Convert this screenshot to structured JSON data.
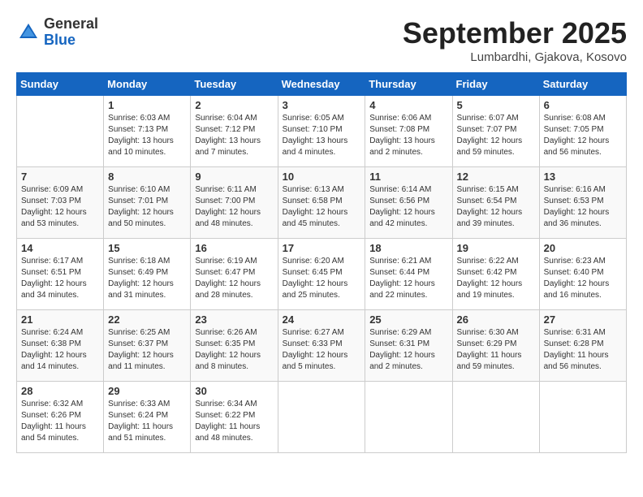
{
  "header": {
    "logo": {
      "line1": "General",
      "line2": "Blue"
    },
    "title": "September 2025",
    "subtitle": "Lumbardhi, Gjakova, Kosovo"
  },
  "weekdays": [
    "Sunday",
    "Monday",
    "Tuesday",
    "Wednesday",
    "Thursday",
    "Friday",
    "Saturday"
  ],
  "weeks": [
    [
      {
        "day": "",
        "sunrise": "",
        "sunset": "",
        "daylight": ""
      },
      {
        "day": "1",
        "sunrise": "Sunrise: 6:03 AM",
        "sunset": "Sunset: 7:13 PM",
        "daylight": "Daylight: 13 hours and 10 minutes."
      },
      {
        "day": "2",
        "sunrise": "Sunrise: 6:04 AM",
        "sunset": "Sunset: 7:12 PM",
        "daylight": "Daylight: 13 hours and 7 minutes."
      },
      {
        "day": "3",
        "sunrise": "Sunrise: 6:05 AM",
        "sunset": "Sunset: 7:10 PM",
        "daylight": "Daylight: 13 hours and 4 minutes."
      },
      {
        "day": "4",
        "sunrise": "Sunrise: 6:06 AM",
        "sunset": "Sunset: 7:08 PM",
        "daylight": "Daylight: 13 hours and 2 minutes."
      },
      {
        "day": "5",
        "sunrise": "Sunrise: 6:07 AM",
        "sunset": "Sunset: 7:07 PM",
        "daylight": "Daylight: 12 hours and 59 minutes."
      },
      {
        "day": "6",
        "sunrise": "Sunrise: 6:08 AM",
        "sunset": "Sunset: 7:05 PM",
        "daylight": "Daylight: 12 hours and 56 minutes."
      }
    ],
    [
      {
        "day": "7",
        "sunrise": "Sunrise: 6:09 AM",
        "sunset": "Sunset: 7:03 PM",
        "daylight": "Daylight: 12 hours and 53 minutes."
      },
      {
        "day": "8",
        "sunrise": "Sunrise: 6:10 AM",
        "sunset": "Sunset: 7:01 PM",
        "daylight": "Daylight: 12 hours and 50 minutes."
      },
      {
        "day": "9",
        "sunrise": "Sunrise: 6:11 AM",
        "sunset": "Sunset: 7:00 PM",
        "daylight": "Daylight: 12 hours and 48 minutes."
      },
      {
        "day": "10",
        "sunrise": "Sunrise: 6:13 AM",
        "sunset": "Sunset: 6:58 PM",
        "daylight": "Daylight: 12 hours and 45 minutes."
      },
      {
        "day": "11",
        "sunrise": "Sunrise: 6:14 AM",
        "sunset": "Sunset: 6:56 PM",
        "daylight": "Daylight: 12 hours and 42 minutes."
      },
      {
        "day": "12",
        "sunrise": "Sunrise: 6:15 AM",
        "sunset": "Sunset: 6:54 PM",
        "daylight": "Daylight: 12 hours and 39 minutes."
      },
      {
        "day": "13",
        "sunrise": "Sunrise: 6:16 AM",
        "sunset": "Sunset: 6:53 PM",
        "daylight": "Daylight: 12 hours and 36 minutes."
      }
    ],
    [
      {
        "day": "14",
        "sunrise": "Sunrise: 6:17 AM",
        "sunset": "Sunset: 6:51 PM",
        "daylight": "Daylight: 12 hours and 34 minutes."
      },
      {
        "day": "15",
        "sunrise": "Sunrise: 6:18 AM",
        "sunset": "Sunset: 6:49 PM",
        "daylight": "Daylight: 12 hours and 31 minutes."
      },
      {
        "day": "16",
        "sunrise": "Sunrise: 6:19 AM",
        "sunset": "Sunset: 6:47 PM",
        "daylight": "Daylight: 12 hours and 28 minutes."
      },
      {
        "day": "17",
        "sunrise": "Sunrise: 6:20 AM",
        "sunset": "Sunset: 6:45 PM",
        "daylight": "Daylight: 12 hours and 25 minutes."
      },
      {
        "day": "18",
        "sunrise": "Sunrise: 6:21 AM",
        "sunset": "Sunset: 6:44 PM",
        "daylight": "Daylight: 12 hours and 22 minutes."
      },
      {
        "day": "19",
        "sunrise": "Sunrise: 6:22 AM",
        "sunset": "Sunset: 6:42 PM",
        "daylight": "Daylight: 12 hours and 19 minutes."
      },
      {
        "day": "20",
        "sunrise": "Sunrise: 6:23 AM",
        "sunset": "Sunset: 6:40 PM",
        "daylight": "Daylight: 12 hours and 16 minutes."
      }
    ],
    [
      {
        "day": "21",
        "sunrise": "Sunrise: 6:24 AM",
        "sunset": "Sunset: 6:38 PM",
        "daylight": "Daylight: 12 hours and 14 minutes."
      },
      {
        "day": "22",
        "sunrise": "Sunrise: 6:25 AM",
        "sunset": "Sunset: 6:37 PM",
        "daylight": "Daylight: 12 hours and 11 minutes."
      },
      {
        "day": "23",
        "sunrise": "Sunrise: 6:26 AM",
        "sunset": "Sunset: 6:35 PM",
        "daylight": "Daylight: 12 hours and 8 minutes."
      },
      {
        "day": "24",
        "sunrise": "Sunrise: 6:27 AM",
        "sunset": "Sunset: 6:33 PM",
        "daylight": "Daylight: 12 hours and 5 minutes."
      },
      {
        "day": "25",
        "sunrise": "Sunrise: 6:29 AM",
        "sunset": "Sunset: 6:31 PM",
        "daylight": "Daylight: 12 hours and 2 minutes."
      },
      {
        "day": "26",
        "sunrise": "Sunrise: 6:30 AM",
        "sunset": "Sunset: 6:29 PM",
        "daylight": "Daylight: 11 hours and 59 minutes."
      },
      {
        "day": "27",
        "sunrise": "Sunrise: 6:31 AM",
        "sunset": "Sunset: 6:28 PM",
        "daylight": "Daylight: 11 hours and 56 minutes."
      }
    ],
    [
      {
        "day": "28",
        "sunrise": "Sunrise: 6:32 AM",
        "sunset": "Sunset: 6:26 PM",
        "daylight": "Daylight: 11 hours and 54 minutes."
      },
      {
        "day": "29",
        "sunrise": "Sunrise: 6:33 AM",
        "sunset": "Sunset: 6:24 PM",
        "daylight": "Daylight: 11 hours and 51 minutes."
      },
      {
        "day": "30",
        "sunrise": "Sunrise: 6:34 AM",
        "sunset": "Sunset: 6:22 PM",
        "daylight": "Daylight: 11 hours and 48 minutes."
      },
      {
        "day": "",
        "sunrise": "",
        "sunset": "",
        "daylight": ""
      },
      {
        "day": "",
        "sunrise": "",
        "sunset": "",
        "daylight": ""
      },
      {
        "day": "",
        "sunrise": "",
        "sunset": "",
        "daylight": ""
      },
      {
        "day": "",
        "sunrise": "",
        "sunset": "",
        "daylight": ""
      }
    ]
  ]
}
